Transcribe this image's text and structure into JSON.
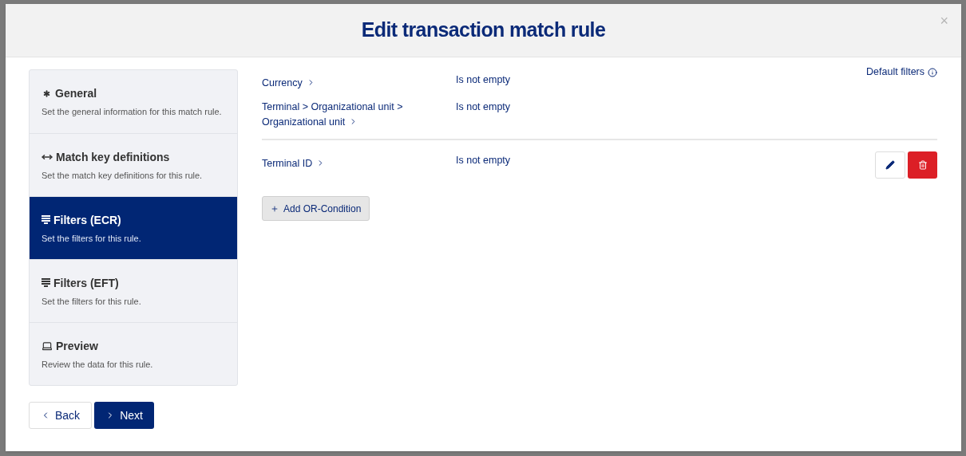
{
  "dialog": {
    "title": "Edit transaction match rule",
    "close": "×"
  },
  "steps": [
    {
      "title": "General",
      "description": "Set the general information for this match rule.",
      "selected": false
    },
    {
      "title": "Match key definitions",
      "description": "Set the match key definitions for this rule.",
      "selected": false
    },
    {
      "title": "Filters (ECR)",
      "description": "Set the filters for this rule.",
      "selected": true
    },
    {
      "title": "Filters (EFT)",
      "description": "Set the filters for this rule.",
      "selected": false
    },
    {
      "title": "Preview",
      "description": "Review the data for this rule.",
      "selected": false
    }
  ],
  "default_filters_link": "Default filters",
  "condition_groups": [
    {
      "editable": false,
      "conditions": [
        {
          "field": "Currency",
          "operator": "Is not empty"
        },
        {
          "field": "Terminal > Organizational unit > Organizational unit",
          "operator": "Is not empty"
        }
      ]
    },
    {
      "editable": true,
      "conditions": [
        {
          "field": "Terminal ID",
          "operator": "Is not empty"
        }
      ]
    }
  ],
  "add_button": "Add OR-Condition",
  "back_button": "Back",
  "next_button": "Next"
}
